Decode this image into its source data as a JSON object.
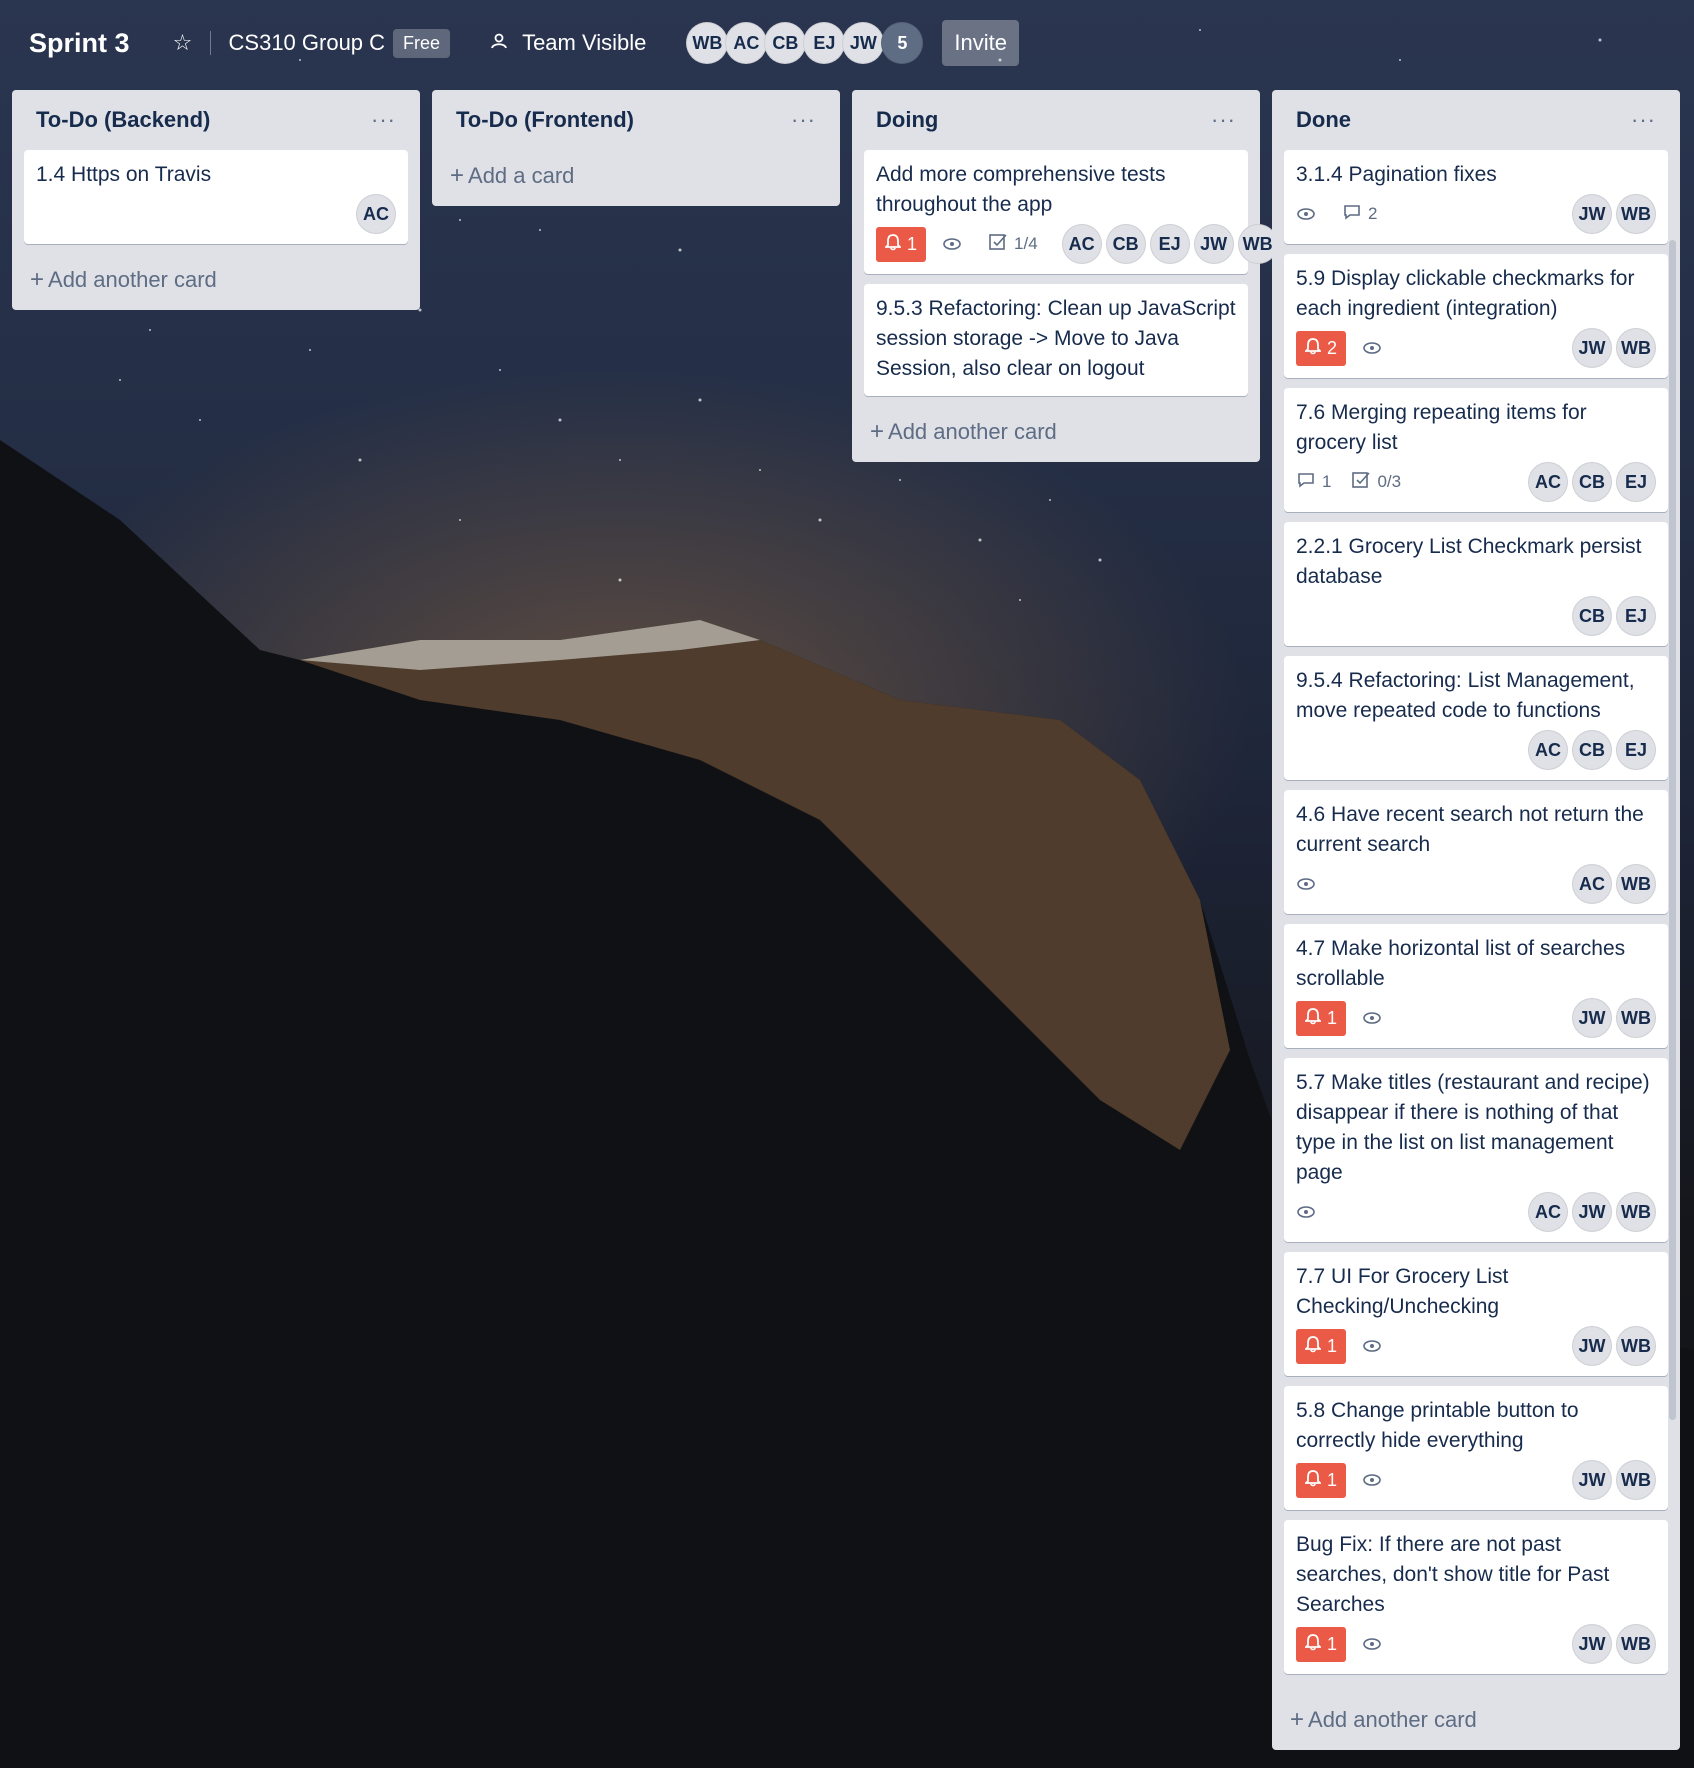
{
  "header": {
    "title": "Sprint 3",
    "team_name": "CS310 Group C",
    "plan_badge": "Free",
    "visibility": "Team Visible",
    "members": [
      "WB",
      "AC",
      "CB",
      "EJ",
      "JW"
    ],
    "members_more": "5",
    "invite_label": "Invite"
  },
  "lists": [
    {
      "title": "To-Do (Backend)",
      "menu": "···",
      "add_label": "Add another card",
      "cards": [
        {
          "title": "1.4 Https on Travis",
          "members": [
            "AC"
          ]
        }
      ]
    },
    {
      "title": "To-Do (Frontend)",
      "menu": "···",
      "add_label": "Add a card",
      "cards": []
    },
    {
      "title": "Doing",
      "menu": "···",
      "add_label": "Add another card",
      "cards": [
        {
          "title": "Add more comprehensive tests throughout the app",
          "due": "1",
          "checklist": "1/4",
          "members": [
            "AC",
            "CB",
            "EJ",
            "JW",
            "WB"
          ]
        },
        {
          "title": "9.5.3 Refactoring: Clean up JavaScript session storage -> Move to Java Session, also clear on logout"
        }
      ]
    },
    {
      "title": "Done",
      "menu": "···",
      "add_label": "Add another card",
      "cards": [
        {
          "title": "3.1.4 Pagination fixes",
          "comments": "2",
          "members": [
            "JW",
            "WB"
          ]
        },
        {
          "title": "5.9 Display clickable checkmarks for each ingredient (integration)",
          "due": "2",
          "members": [
            "JW",
            "WB"
          ]
        },
        {
          "title": "7.6 Merging repeating items for grocery list",
          "comments": "1",
          "checklist": "0/3",
          "members": [
            "AC",
            "CB",
            "EJ"
          ]
        },
        {
          "title": "2.2.1 Grocery List Checkmark persist database",
          "members": [
            "CB",
            "EJ"
          ]
        },
        {
          "title": "9.5.4 Refactoring: List Management, move repeated code to functions",
          "members": [
            "AC",
            "CB",
            "EJ"
          ]
        },
        {
          "title": "4.6 Have recent search not return the current search",
          "members": [
            "AC",
            "WB"
          ]
        },
        {
          "title": "4.7 Make horizontal list of searches scrollable",
          "due": "1",
          "members": [
            "JW",
            "WB"
          ]
        },
        {
          "title": "5.7 Make titles (restaurant and recipe) disappear if there is nothing of that type in the list on list management page",
          "members": [
            "AC",
            "JW",
            "WB"
          ]
        },
        {
          "title": "7.7 UI For Grocery List Checking/Unchecking",
          "due": "1",
          "members": [
            "JW",
            "WB"
          ]
        },
        {
          "title": "5.8 Change printable button to correctly hide everything",
          "due": "1",
          "members": [
            "JW",
            "WB"
          ]
        },
        {
          "title": "Bug Fix: If there are not past searches, don't show title for Past Searches",
          "due": "1",
          "members": [
            "JW",
            "WB"
          ]
        }
      ]
    }
  ],
  "icons": {
    "star": "star-icon",
    "visibility": "team-icon",
    "watch": "eye-icon",
    "comment": "comment-icon",
    "checklist": "checklist-icon",
    "due": "bell-icon",
    "add": "plus-icon"
  },
  "colors": {
    "due_badge": "#eb5a46",
    "list_bg": "#dfe1e6",
    "avatar_bg": "#dfe1e6"
  }
}
